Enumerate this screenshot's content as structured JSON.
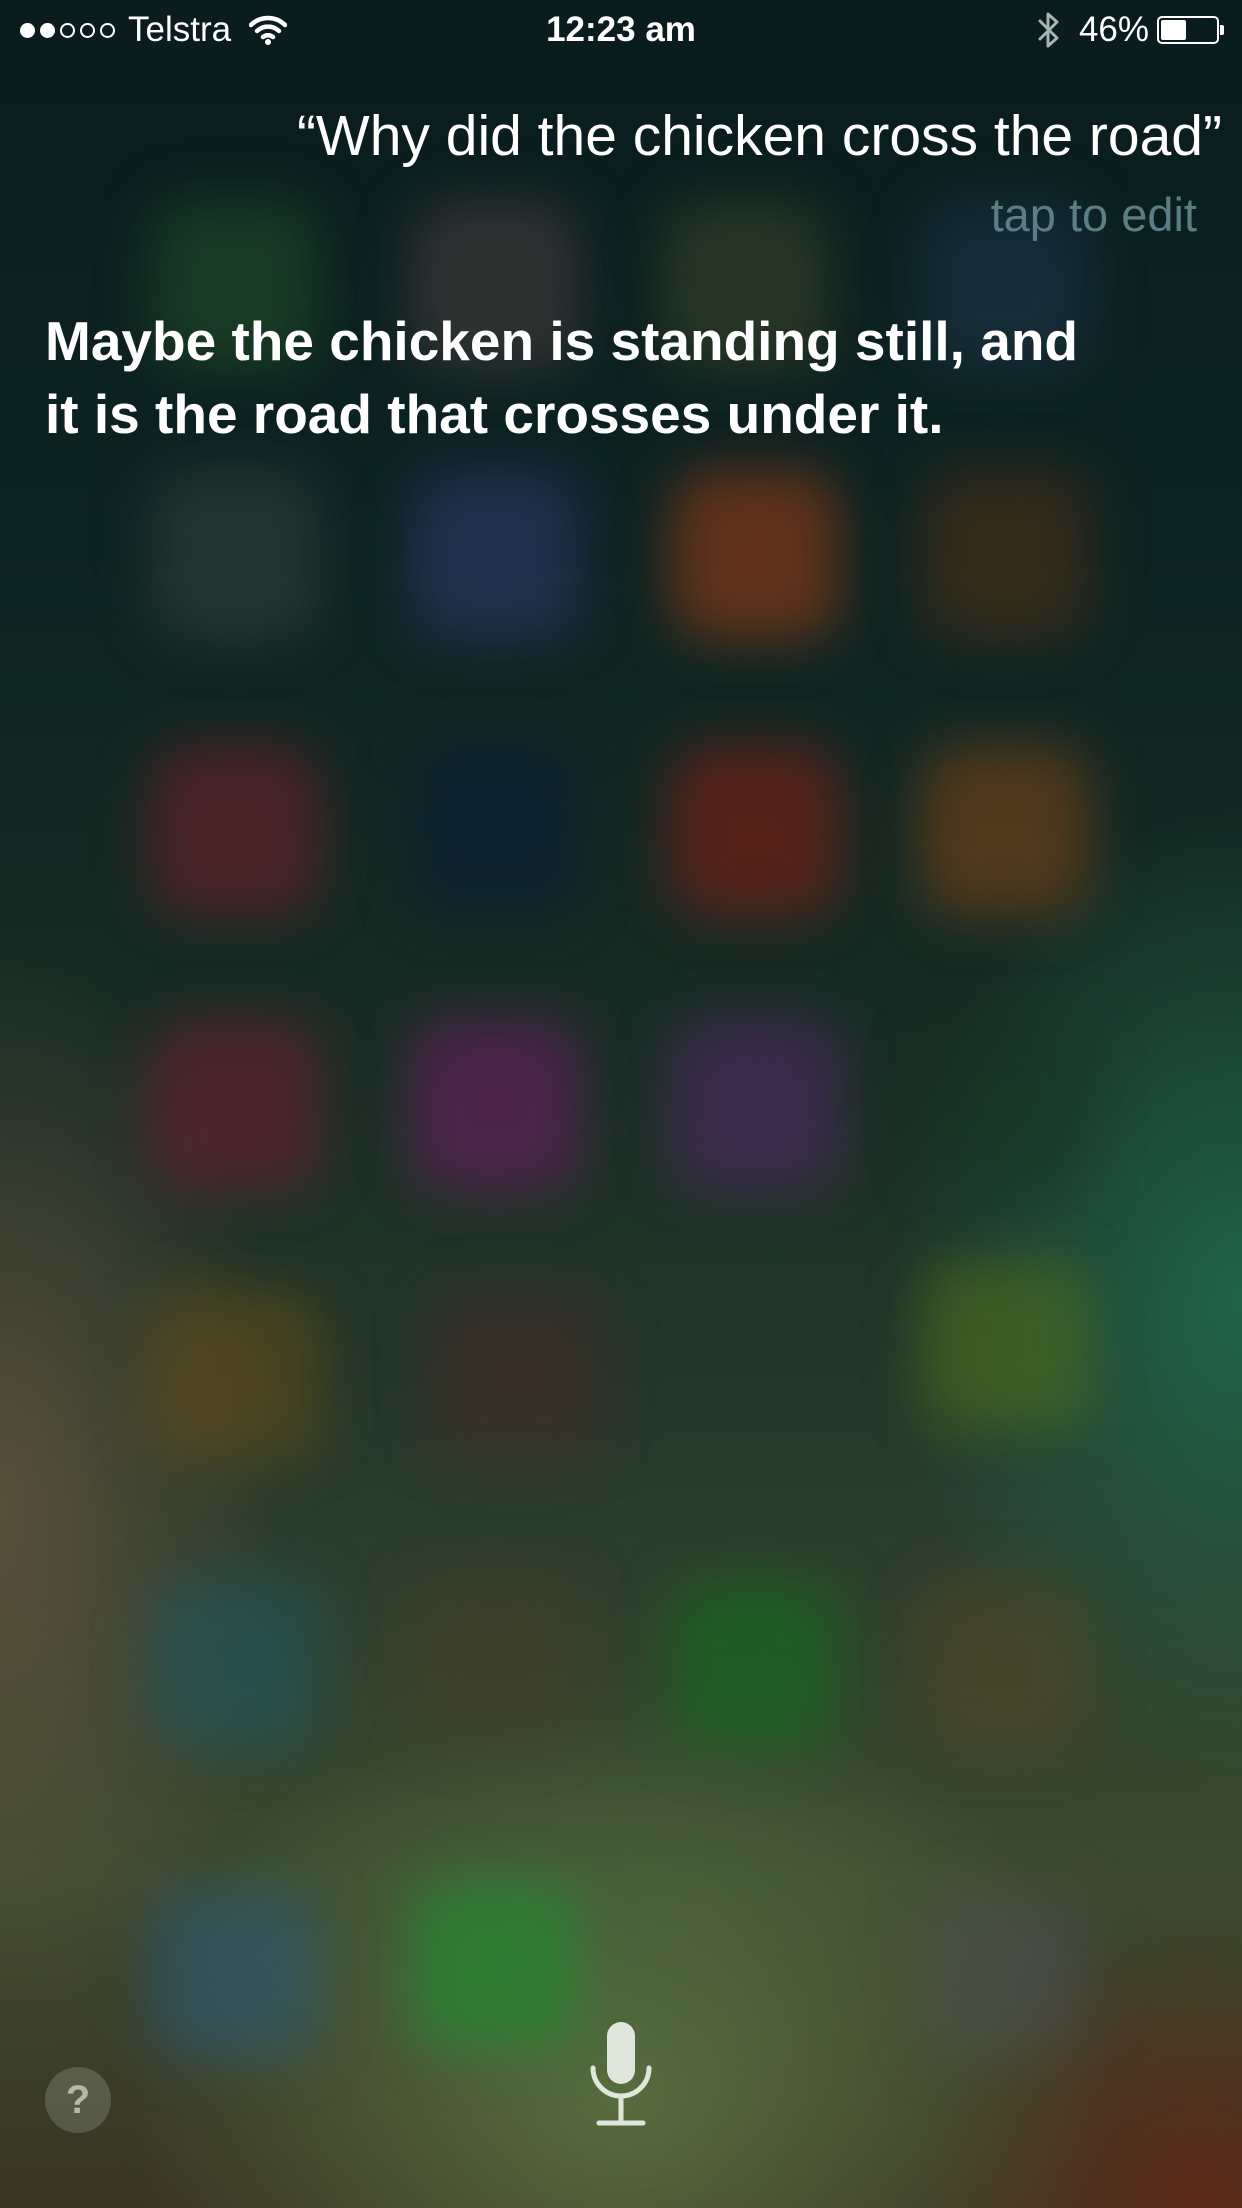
{
  "status_bar": {
    "carrier": "Telstra",
    "signal_bars_filled": 2,
    "signal_bars_total": 5,
    "time": "12:23 am",
    "battery_percent": "46%",
    "battery_level": 0.46,
    "icons": [
      "wifi-icon",
      "bluetooth-icon",
      "battery-icon"
    ]
  },
  "siri": {
    "query": "“Why did the chicken cross the road”",
    "tap_to_edit": "tap to edit",
    "response": "Maybe the chicken is standing still, and it is the road that crosses under it."
  },
  "controls": {
    "help_label": "?",
    "mic_icon": "microphone-icon"
  },
  "colors": {
    "tap_to_edit": "#5d7d84",
    "text": "#ffffff"
  }
}
